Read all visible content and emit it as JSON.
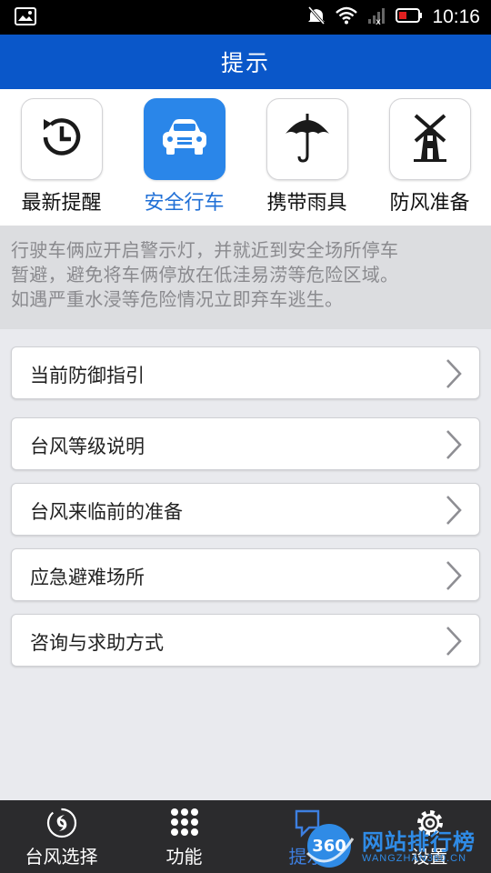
{
  "status_bar": {
    "time": "10:16"
  },
  "header": {
    "title": "提示"
  },
  "categories": [
    {
      "label": "最新提醒",
      "icon": "clock-history-icon",
      "active": false
    },
    {
      "label": "安全行车",
      "icon": "car-icon",
      "active": true
    },
    {
      "label": "携带雨具",
      "icon": "umbrella-icon",
      "active": false
    },
    {
      "label": "防风准备",
      "icon": "windmill-icon",
      "active": false
    }
  ],
  "info": {
    "lines": [
      "行驶车俩应开启警示灯，并就近到安全场所停车",
      "暂避，避免将车俩停放在低洼易涝等危险区域。",
      "如遇严重水浸等危险情况立即弃车逃生。"
    ]
  },
  "menu": [
    {
      "label": "当前防御指引"
    },
    {
      "label": "台风等级说明"
    },
    {
      "label": "台风来临前的准备"
    },
    {
      "label": "应急避难场所"
    },
    {
      "label": "咨询与求助方式"
    }
  ],
  "bottom_nav": [
    {
      "label": "台风选择",
      "icon": "typhoon-icon"
    },
    {
      "label": "功能",
      "icon": "grid-icon"
    },
    {
      "label": "提示",
      "icon": "tips-icon",
      "active": true
    },
    {
      "label": "设置",
      "icon": "gear-icon"
    }
  ],
  "watermark": {
    "text": "网站排行榜",
    "sub": "WANGZHAN360.CN",
    "badge": "360"
  },
  "colors": {
    "header": "#0a57c9",
    "active_tile": "#2a86e9",
    "active_text": "#1f6fd6",
    "nav_bg": "#2b2b2d"
  }
}
